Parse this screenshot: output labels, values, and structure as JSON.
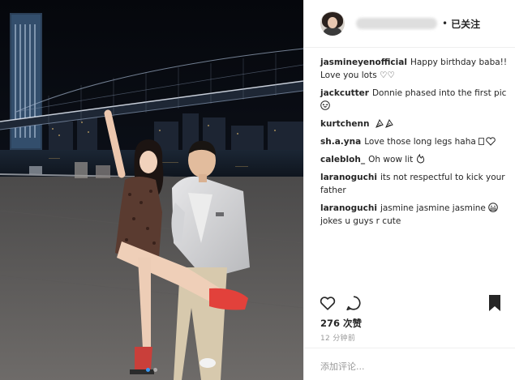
{
  "header": {
    "username_label": "",
    "separator": "•",
    "follow_state": "已关注"
  },
  "comments": [
    {
      "user": "jasmineyenofficial",
      "text": "Happy birthday baba!! Love you lots ♡♡"
    },
    {
      "user": "jackcutter",
      "text": "Donnie phased into the first pic",
      "emoji": "laughing-face-icon"
    },
    {
      "user": "kurtchenn",
      "text": "",
      "emoji": "party-popper-icon"
    },
    {
      "user": "sh.a.yna",
      "text": "Love those long legs haha",
      "emoji": "heart-icon"
    },
    {
      "user": "calebloh_",
      "text": "Oh wow lit",
      "emoji": "fire-icon"
    },
    {
      "user": "laranoguchi",
      "text": "its not respectful to kick your father"
    },
    {
      "user": "laranoguchi",
      "text": "jasmine jasmine jasmine",
      "text_after": "jokes u guys r cute",
      "emoji": "grimacing-face-icon"
    }
  ],
  "actions": {
    "like_icon": "heart-icon",
    "comment_icon": "speech-bubble-icon",
    "save_icon": "bookmark-icon"
  },
  "likes": "276 次赞",
  "timestamp": "12 分钟前",
  "comment_box": {
    "placeholder": "添加评论..."
  },
  "carousel": {
    "count": 2,
    "active": 1
  },
  "colors": {
    "accent": "#3897f0",
    "text": "#262626",
    "muted": "#999999"
  }
}
